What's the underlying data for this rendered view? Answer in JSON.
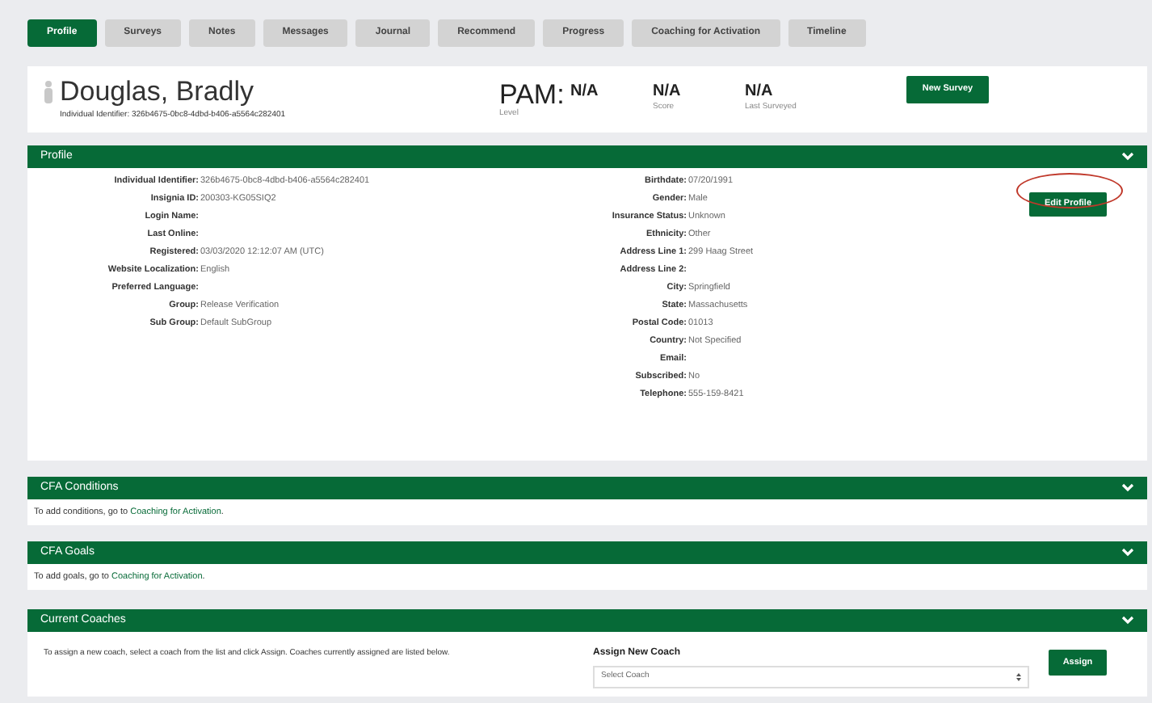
{
  "tabs": [
    {
      "label": "Profile",
      "selected": true
    },
    {
      "label": "Surveys",
      "selected": false
    },
    {
      "label": "Notes",
      "selected": false
    },
    {
      "label": "Messages",
      "selected": false
    },
    {
      "label": "Journal",
      "selected": false
    },
    {
      "label": "Recommend",
      "selected": false
    },
    {
      "label": "Progress",
      "selected": false
    },
    {
      "label": "Coaching for Activation",
      "selected": false
    },
    {
      "label": "Timeline",
      "selected": false
    }
  ],
  "header": {
    "name": "Douglas, Bradly",
    "identifier": "Individual Identifier: 326b4675-0bc8-4dbd-b406-a5564c282401",
    "pam_label": "PAM:",
    "stats": [
      {
        "value": "N/A",
        "caption": "Level"
      },
      {
        "value": "N/A",
        "caption": "Score"
      },
      {
        "value": "N/A",
        "caption": "Last Surveyed"
      }
    ],
    "button": "New Survey"
  },
  "profile": {
    "title": "Profile",
    "edit_button": "Edit Profile",
    "edit_highlighted": true,
    "left_fields": [
      {
        "label": "Individual Identifier:",
        "value": "326b4675-0bc8-4dbd-b406-a5564c282401"
      },
      {
        "label": "Insignia ID:",
        "value": "200303-KG05SIQ2"
      },
      {
        "label": "Login Name:"
      },
      {
        "label": "Last Online:"
      },
      {
        "label": "Registered:",
        "value": "03/03/2020 12:12:07 AM (UTC)"
      },
      {
        "label": "Website Localization:",
        "value": "English"
      },
      {
        "label": "Preferred Language:"
      },
      {
        "label": "Group:",
        "value": "Release Verification"
      },
      {
        "label": "Sub Group:",
        "value": "Default SubGroup"
      }
    ],
    "right_fields": [
      {
        "label": "Birthdate:",
        "value": "07/20/1991"
      },
      {
        "label": "Gender:",
        "value": "Male"
      },
      {
        "label": "Insurance Status:",
        "value": "Unknown"
      },
      {
        "label": "Ethnicity:",
        "value": "Other"
      },
      {
        "label": "Address Line 1:",
        "value": "299 Haag Street"
      },
      {
        "label": "Address Line 2:"
      },
      {
        "label": "City:",
        "value": "Springfield"
      },
      {
        "label": "State:",
        "value": "Massachusetts"
      },
      {
        "label": "Postal Code:",
        "value": "01013"
      },
      {
        "label": "Country:",
        "value": "Not Specified"
      },
      {
        "label": "Email:"
      },
      {
        "label": "Subscribed:",
        "value": "No"
      },
      {
        "label": "Telephone:",
        "value": "555-159-8421"
      }
    ]
  },
  "cfa_sections": [
    {
      "title": "CFA Conditions",
      "text_before": "To add conditions, go to ",
      "link": "Coaching for Activation",
      "text_after": "."
    },
    {
      "title": "CFA Goals",
      "text_before": "To add goals, go to ",
      "link": "Coaching for Activation",
      "text_after": "."
    }
  ],
  "coaches": {
    "title": "Current Coaches",
    "instructions": "To assign a new coach, select a coach from the list and click Assign. Coaches currently assigned are listed below.",
    "assign_label": "Assign New Coach",
    "select_placeholder": "Select Coach",
    "button": "Assign"
  }
}
